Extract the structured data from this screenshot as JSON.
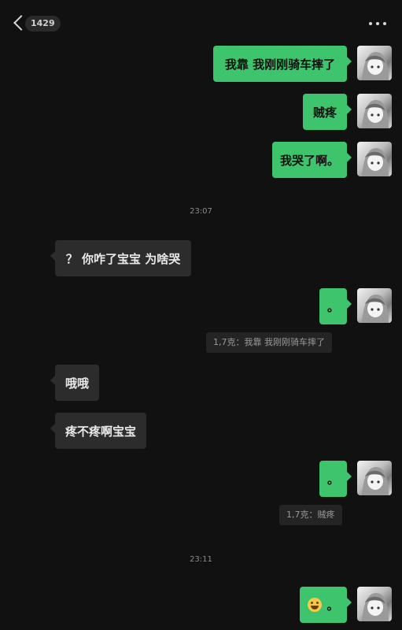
{
  "header": {
    "badge_count": "1429"
  },
  "messages": [
    {
      "side": "me",
      "text": "我靠  我刚刚骑车摔了"
    },
    {
      "side": "me",
      "text": "贼疼"
    },
    {
      "side": "me",
      "text": "我哭了啊。"
    },
    {
      "side": "them",
      "text": "？ 你咋了宝宝  为啥哭"
    },
    {
      "side": "me",
      "text": "。"
    },
    {
      "side": "them",
      "text": "哦哦"
    },
    {
      "side": "them",
      "text": "疼不疼啊宝宝"
    },
    {
      "side": "me",
      "text": "。"
    },
    {
      "side": "me",
      "text": "。",
      "emoji": "laughing-tears-emoji"
    }
  ],
  "timestamps": [
    "23:07",
    "23:11"
  ],
  "quotes": [
    {
      "text": "1,7克：我靠  我刚刚骑车摔了"
    },
    {
      "text": "1,7克：贼疼"
    }
  ],
  "colors": {
    "background": "#111111",
    "my_bubble": "#3ec46d",
    "their_bubble": "#2c2c2c"
  }
}
